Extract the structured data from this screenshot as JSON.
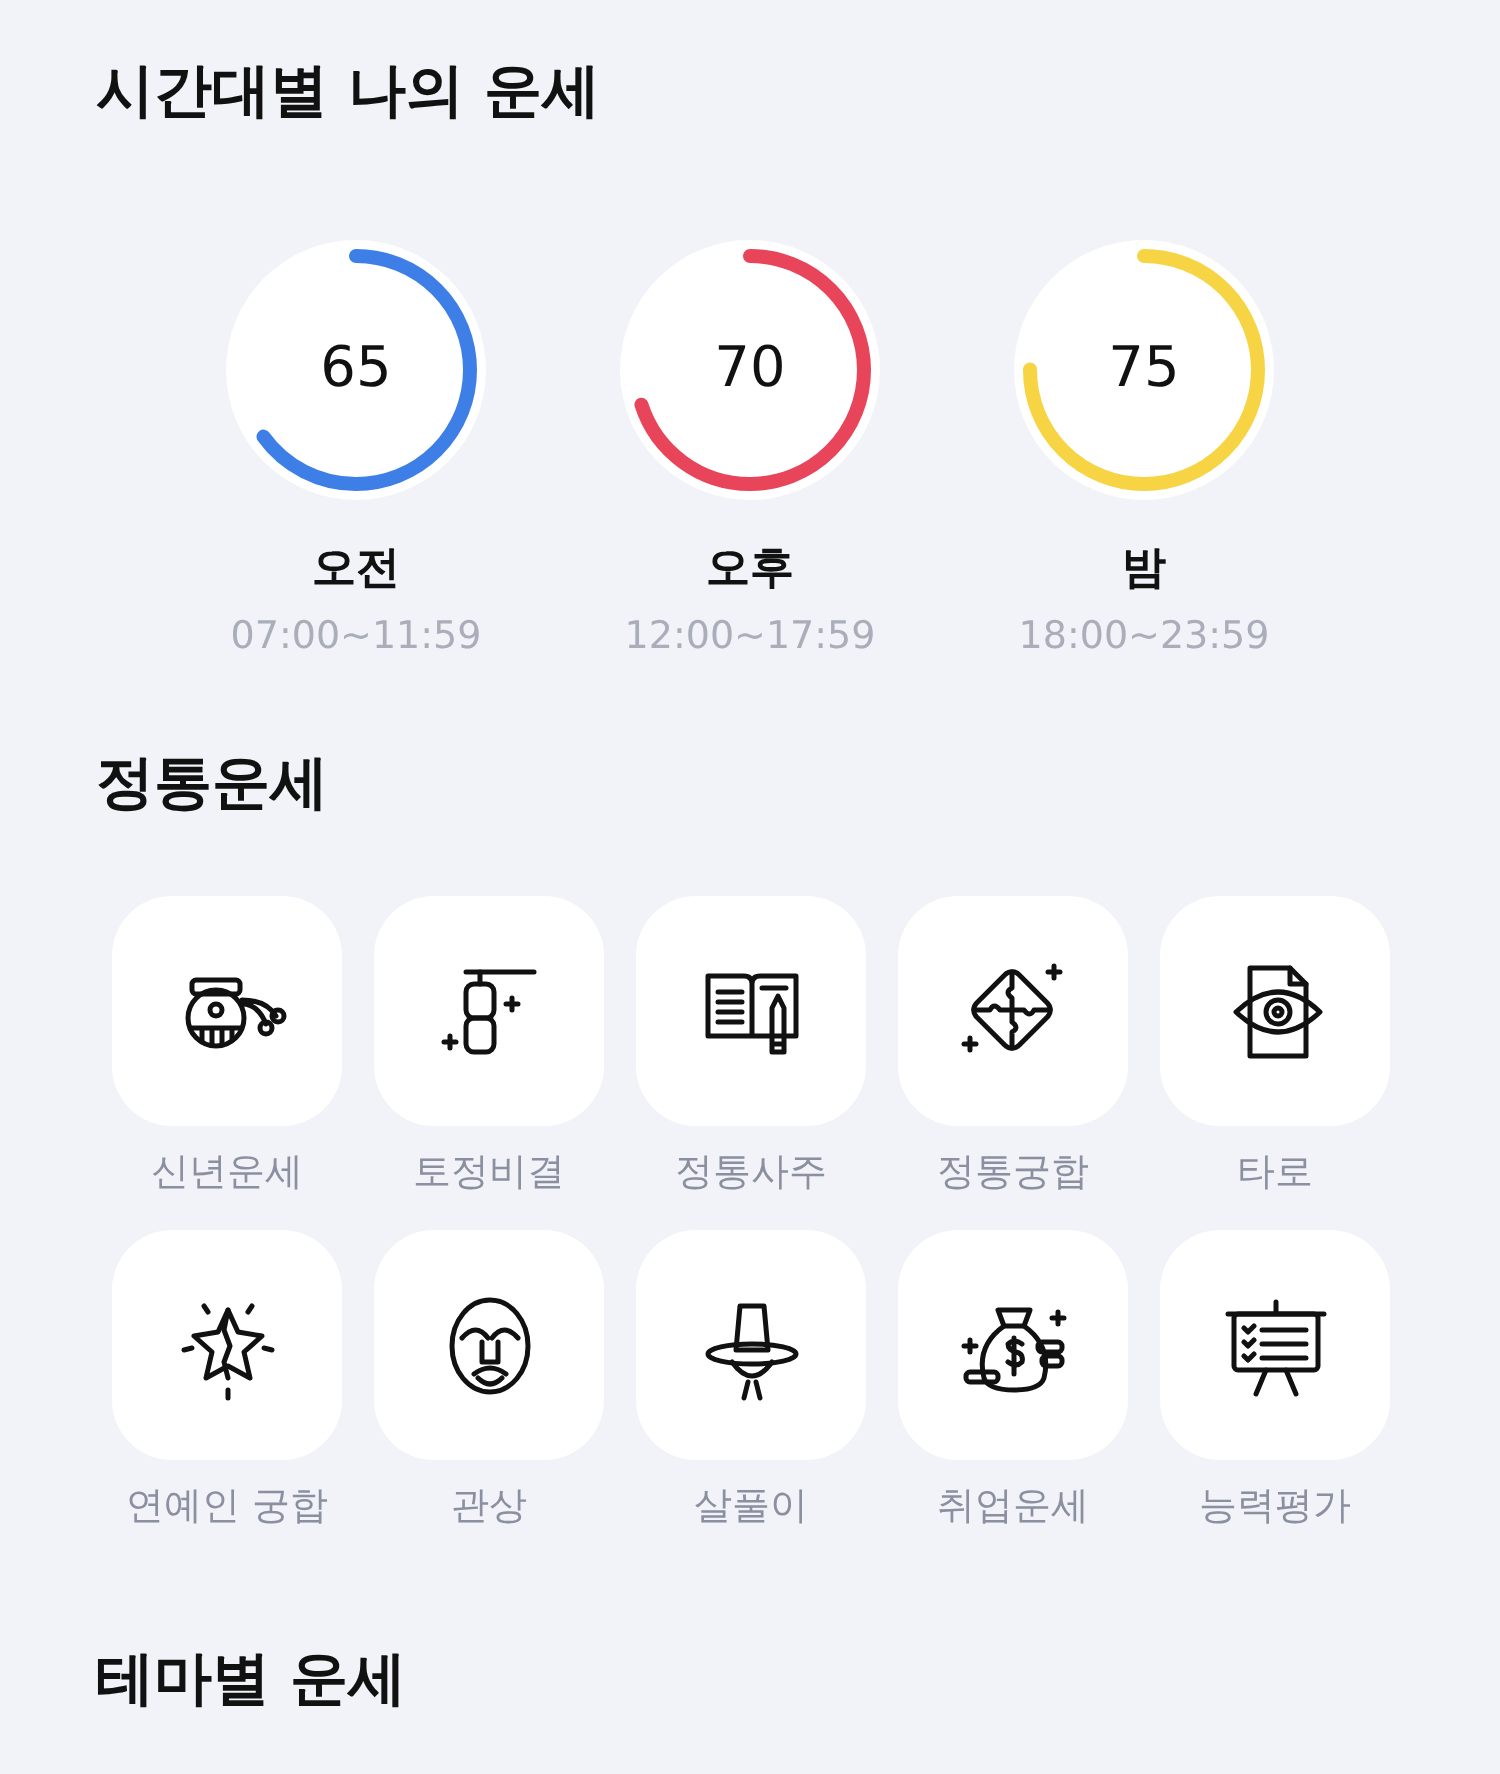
{
  "title": "시간대별 나의 운세",
  "periods": [
    {
      "score": "65",
      "level": 0.65,
      "color": "#3d7fe6",
      "name": "오전",
      "range": "07:00~11:59"
    },
    {
      "score": "70",
      "level": 0.7,
      "color": "#e8445a",
      "name": "오후",
      "range": "12:00~17:59"
    },
    {
      "score": "75",
      "level": 0.75,
      "color": "#f7d443",
      "name": "밤",
      "range": "18:00~23:59"
    }
  ],
  "section_title": "정통운세",
  "items": [
    {
      "label": "신년운세"
    },
    {
      "label": "토정비결"
    },
    {
      "label": "정통사주"
    },
    {
      "label": "정통궁합"
    },
    {
      "label": "타로"
    },
    {
      "label": "연예인 궁합"
    },
    {
      "label": "관상"
    },
    {
      "label": "살풀이"
    },
    {
      "label": "취업운세"
    },
    {
      "label": "능력평가"
    }
  ],
  "next_section_title": "테마별 운세"
}
